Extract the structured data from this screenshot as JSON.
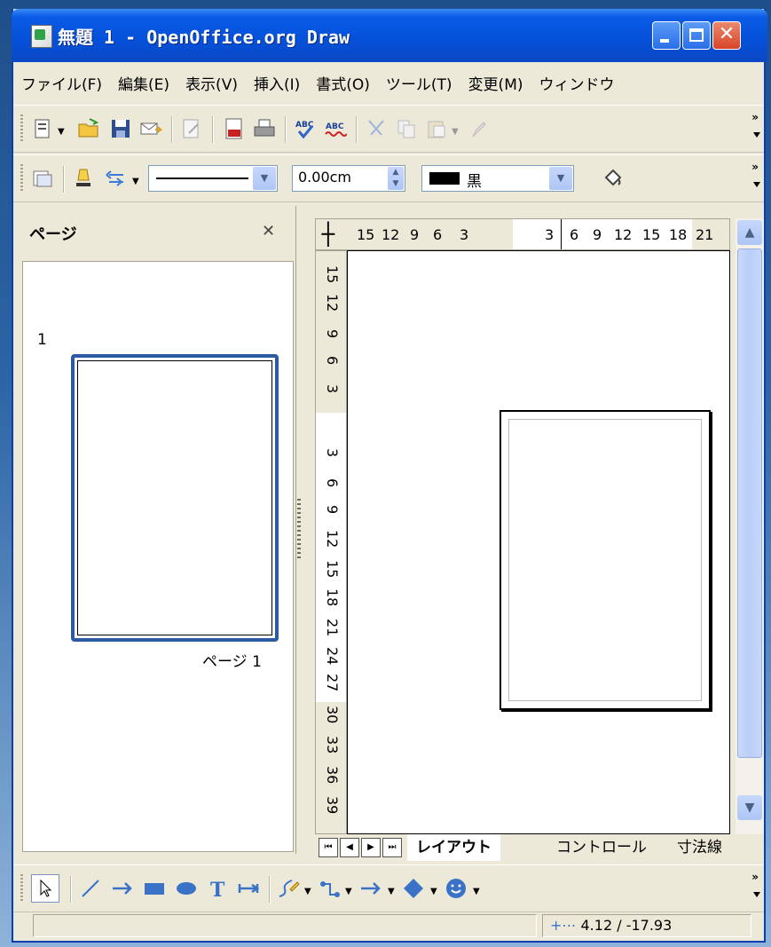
{
  "window": {
    "title": "無題 1 - OpenOffice.org Draw"
  },
  "menu": [
    "ファイル(F)",
    "編集(E)",
    "表示(V)",
    "挿入(I)",
    "書式(O)",
    "ツール(T)",
    "変更(M)",
    "ウィンドウ"
  ],
  "line_props": {
    "width_value": "0.00cm",
    "color_name": "黒"
  },
  "pages_pane": {
    "title": "ページ",
    "thumb_number": "1",
    "thumb_label": "ページ 1"
  },
  "ruler": {
    "h_left": [
      "15",
      "12",
      "9",
      "6",
      "3"
    ],
    "h_right": [
      "3",
      "6",
      "9",
      "12",
      "15",
      "18",
      "21"
    ],
    "v_top": [
      "15",
      "12",
      "9",
      "6",
      "3"
    ],
    "v_bottom": [
      "3",
      "6",
      "9",
      "12",
      "15",
      "18",
      "21",
      "24",
      "27",
      "30",
      "33",
      "36",
      "39"
    ]
  },
  "tabs": {
    "layout": "レイアウト",
    "controls": "コントロール",
    "dimension": "寸法線"
  },
  "status": {
    "coords": "4.12 / -17.93"
  }
}
